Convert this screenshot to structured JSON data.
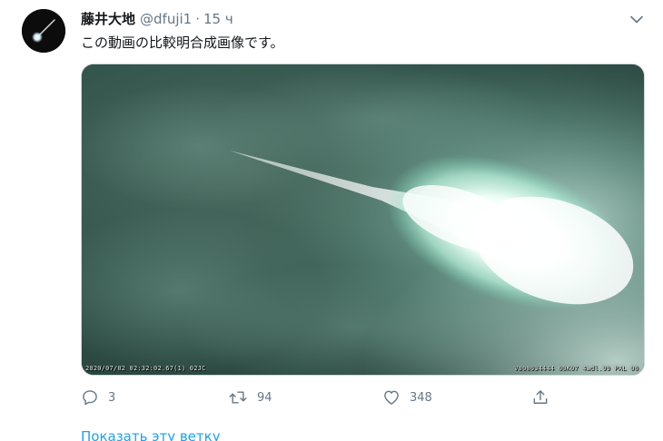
{
  "tweet": {
    "display_name": "藤井大地",
    "handle": "@dfuji1",
    "separator": "·",
    "time": "15 ч",
    "text": "この動画の比較明合成画像です。",
    "avatar_icon": "meteor-avatar-icon",
    "menu_icon": "chevron-down-icon"
  },
  "media": {
    "osd_left": "2020/07/02 02:32:02.67(1) 02JC",
    "osd_right": "V000034444 00K07 4wdl.99 PAL 00"
  },
  "actions": {
    "reply_count": "3",
    "retweet_count": "94",
    "like_count": "348"
  },
  "thread_link": "Показать эту ветку",
  "colors": {
    "link": "#1da1f2",
    "muted": "#657786",
    "text": "#14171a"
  }
}
